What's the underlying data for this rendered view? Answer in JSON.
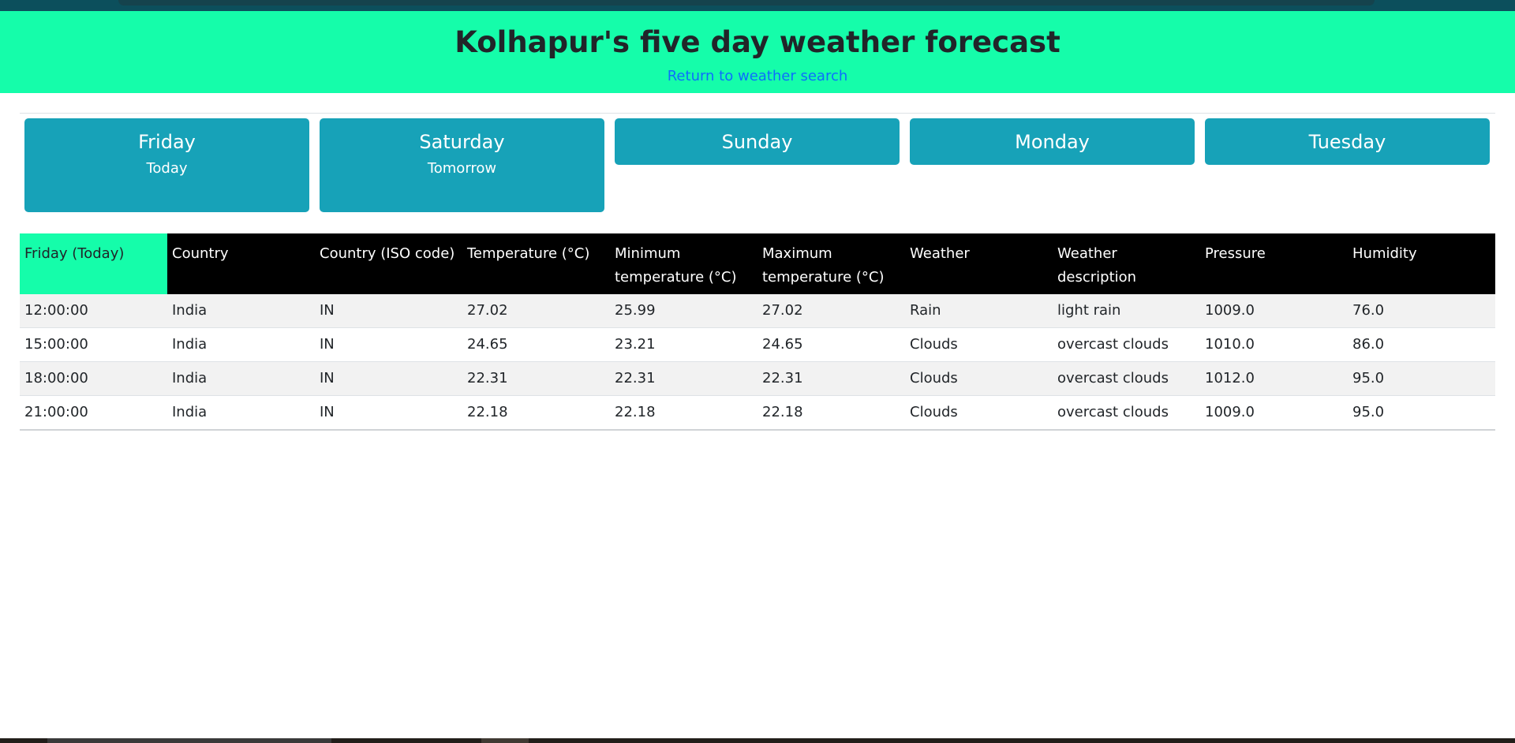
{
  "header": {
    "title": "Kolhapur's five day weather forecast",
    "back_link": "Return to weather search"
  },
  "days": [
    {
      "name": "Friday",
      "sub": "Today"
    },
    {
      "name": "Saturday",
      "sub": "Tomorrow"
    },
    {
      "name": "Sunday",
      "sub": ""
    },
    {
      "name": "Monday",
      "sub": ""
    },
    {
      "name": "Tuesday",
      "sub": ""
    }
  ],
  "table": {
    "columns": [
      "Friday (Today)",
      "Country",
      "Country (ISO code)",
      "Temperature (°C)",
      "Minimum temperature (°C)",
      "Maximum temperature (°C)",
      "Weather",
      "Weather description",
      "Pressure",
      "Humidity"
    ],
    "rows": [
      [
        "12:00:00",
        "India",
        "IN",
        "27.02",
        "25.99",
        "27.02",
        "Rain",
        "light rain",
        "1009.0",
        "76.0"
      ],
      [
        "15:00:00",
        "India",
        "IN",
        "24.65",
        "23.21",
        "24.65",
        "Clouds",
        "overcast clouds",
        "1010.0",
        "86.0"
      ],
      [
        "18:00:00",
        "India",
        "IN",
        "22.31",
        "22.31",
        "22.31",
        "Clouds",
        "overcast clouds",
        "1012.0",
        "95.0"
      ],
      [
        "21:00:00",
        "India",
        "IN",
        "22.18",
        "22.18",
        "22.18",
        "Clouds",
        "overcast clouds",
        "1009.0",
        "95.0"
      ]
    ]
  },
  "colors": {
    "header_bg": "#15fdaa",
    "day_button_bg": "#17a2b8",
    "link": "#0d6efd",
    "table_header_bg": "#000000"
  }
}
